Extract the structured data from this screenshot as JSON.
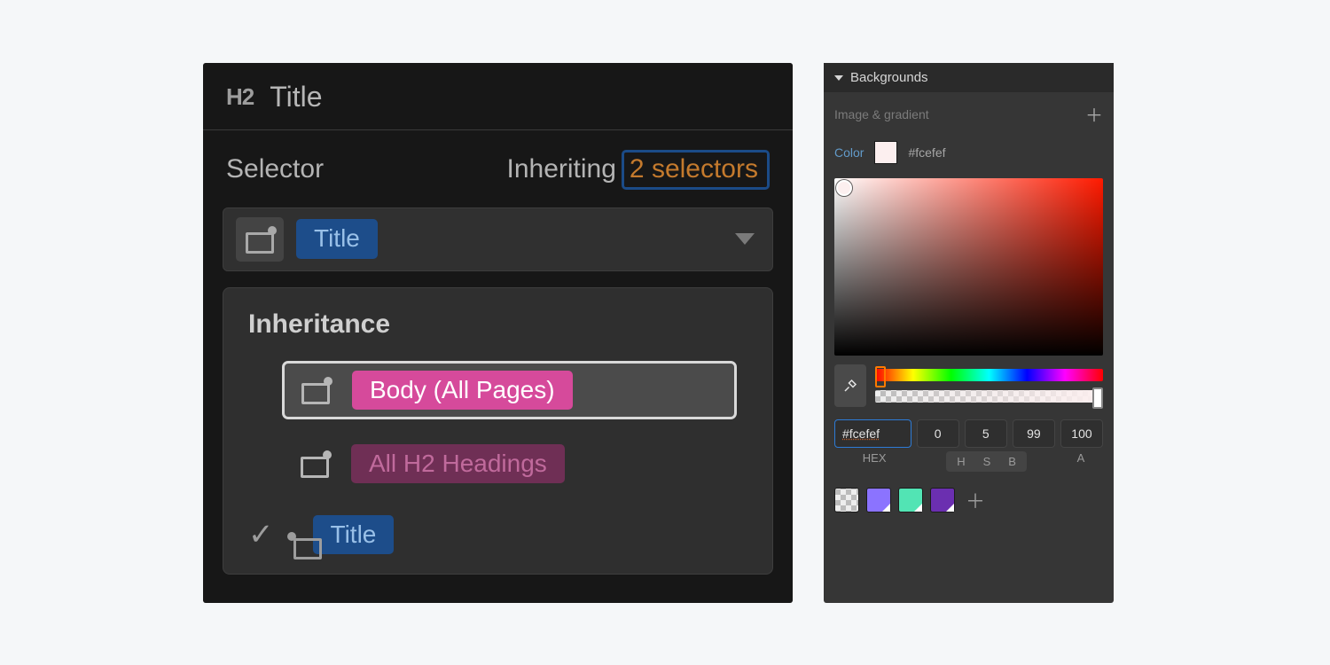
{
  "left": {
    "element_tag": "H2",
    "element_label": "Title",
    "selector_label": "Selector",
    "inheriting_label": "Inheriting",
    "inheriting_count_text": "2 selectors",
    "selector_chip": "Title",
    "inheritance_heading": "Inheritance",
    "inheritance_items": [
      {
        "label": "Body (All Pages)",
        "style": "pink",
        "active": true
      },
      {
        "label": "All H2 Headings",
        "style": "pink-dim",
        "active": false
      }
    ],
    "current_selector": "Title"
  },
  "right": {
    "section_title": "Backgrounds",
    "image_gradient_label": "Image & gradient",
    "color_label": "Color",
    "color_hex_display": "#fcefef",
    "swatch_color": "#fcefef",
    "hex_input": "#fcefef",
    "h": "0",
    "s": "5",
    "b": "99",
    "a": "100",
    "labels": {
      "hex": "HEX",
      "h": "H",
      "s": "S",
      "b": "B",
      "a": "A"
    },
    "swatches": [
      "#8b73ff",
      "#52e4b4",
      "#6b2fb0"
    ]
  }
}
